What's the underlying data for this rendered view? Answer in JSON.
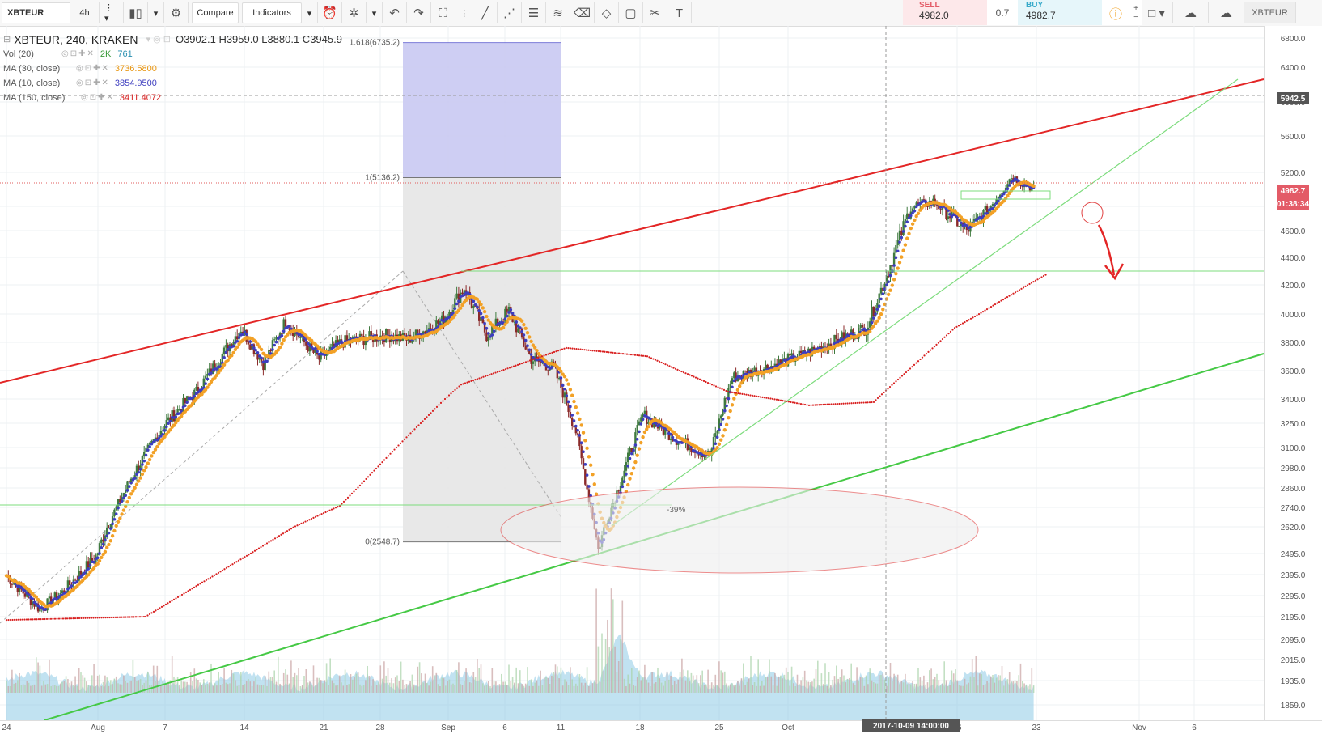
{
  "toolbar": {
    "symbol": "XBTEUR",
    "interval": "4h",
    "compare_label": "Compare",
    "indicators_label": "Indicators",
    "symbol_right": "XBTEUR"
  },
  "trade": {
    "sell_label": "SELL",
    "sell_price": "4982.0",
    "spread": "0.7",
    "buy_label": "BUY",
    "buy_price": "4982.7"
  },
  "legend": {
    "symbol_line": "XBTEUR, 240, KRAKEN",
    "ohlc": "O3902.1  H3959.0  L3880.1  C3945.9",
    "vol_label": "Vol (20)",
    "vol_value1": "2K",
    "vol_value2": "761",
    "ma30_label": "MA (30, close)",
    "ma30_value": "3736.5800",
    "ma10_label": "MA (10, close)",
    "ma10_value": "3854.9500",
    "ma150_label": "MA (150, close)",
    "ma150_value": "3411.4072"
  },
  "colors": {
    "candle_up": "#3f7a3f",
    "candle_down": "#8b2a2a",
    "ma10": "#3d3dbf",
    "ma30": "#f2a126",
    "ma150": "#d81e1e",
    "trend_red": "#e32626",
    "trend_green": "#4bd04b",
    "volume": "#8ecae6"
  },
  "annotations": {
    "fib_1618": "1.618(6735.2)",
    "fib_1": "1(5136.2)",
    "fib_0": "0(2548.7)",
    "pct_drop": "-39%",
    "crosshair_time": "2017-10-09 14:00:00",
    "price_marker_5942": "5942.5",
    "last_price": "4982.7",
    "countdown": "01:38:34"
  },
  "chart_data": {
    "type": "candlestick",
    "title": "XBTEUR, 240, KRAKEN",
    "x_ticks": [
      "24",
      "Aug",
      "7",
      "14",
      "21",
      "28",
      "Sep",
      "6",
      "11",
      "18",
      "25",
      "Oct",
      "16",
      "23",
      "Nov",
      "6"
    ],
    "y_ticks": [
      1859,
      1935,
      2015,
      2095,
      2195,
      2295,
      2395,
      2495,
      2620,
      2740,
      2860,
      2980,
      3100,
      3250,
      3400,
      3600,
      3800,
      4000,
      4200,
      4400,
      4600,
      4800,
      5200,
      5600,
      6000,
      6400,
      6800
    ],
    "axis_scale": "log",
    "ylim": [
      1859,
      6800
    ],
    "x_range": [
      "2017-07-24",
      "2017-11-08"
    ],
    "price_path_dates": [
      "2017-07-24",
      "2017-07-27",
      "2017-07-29",
      "2017-08-01",
      "2017-08-04",
      "2017-08-07",
      "2017-08-10",
      "2017-08-14",
      "2017-08-16",
      "2017-08-18",
      "2017-08-21",
      "2017-08-23",
      "2017-08-27",
      "2017-08-29",
      "2017-09-01",
      "2017-09-03",
      "2017-09-05",
      "2017-09-07",
      "2017-09-09",
      "2017-09-11",
      "2017-09-13",
      "2017-09-15",
      "2017-09-17",
      "2017-09-19",
      "2017-09-22",
      "2017-09-25",
      "2017-09-27",
      "2017-09-30",
      "2017-10-03",
      "2017-10-06",
      "2017-10-09",
      "2017-10-11",
      "2017-10-13",
      "2017-10-15",
      "2017-10-18",
      "2017-10-20",
      "2017-10-22",
      "2017-10-24"
    ],
    "price_path_close": [
      2390,
      2230,
      2310,
      2480,
      2900,
      3230,
      3450,
      3900,
      3650,
      3950,
      3680,
      3800,
      3850,
      3820,
      3950,
      4180,
      3850,
      4020,
      3680,
      3620,
      3200,
      2510,
      2900,
      3300,
      3150,
      3050,
      3550,
      3620,
      3700,
      3800,
      3900,
      4300,
      4800,
      4850,
      4600,
      4780,
      5150,
      5000
    ],
    "series": [
      {
        "name": "MA (10, close)",
        "last_value": 3854.95
      },
      {
        "name": "MA (30, close)",
        "last_value": 3736.58
      },
      {
        "name": "MA (150, close)",
        "last_value": 3411.4072
      },
      {
        "name": "Vol (20)",
        "last_value": "2K"
      }
    ],
    "fibonacci_levels": [
      {
        "label": "1.618",
        "price": 6735.2
      },
      {
        "label": "1",
        "price": 5136.2
      },
      {
        "label": "0",
        "price": 2548.7
      }
    ],
    "horizontal_lines": [
      4200,
      2620,
      5942.5
    ],
    "last_price": 4982.7
  }
}
